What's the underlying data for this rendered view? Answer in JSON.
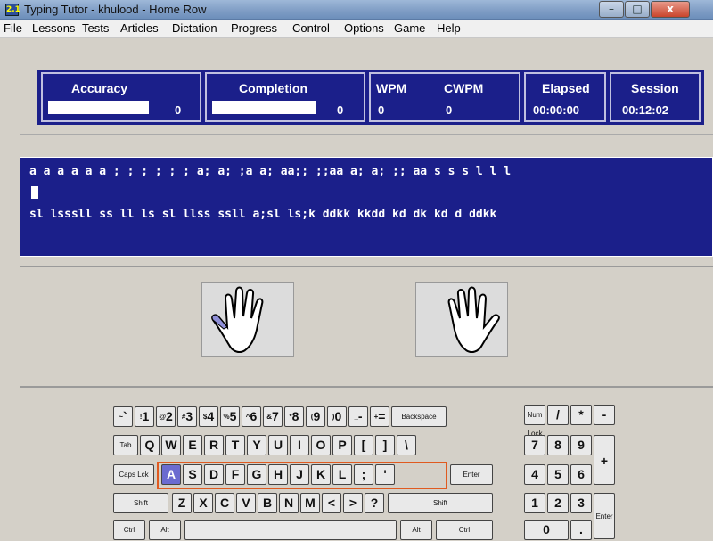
{
  "window": {
    "title": "Typing Tutor - khulood - Home Row",
    "icon_text": "2.1",
    "controls": {
      "minimize": "–",
      "maximize": "□",
      "close": "x"
    }
  },
  "menu": [
    "File",
    "Lessons",
    "Tests",
    "Articles",
    "Dictation",
    "Progress",
    "Control",
    "Options",
    "Game",
    "Help"
  ],
  "stats": {
    "accuracy": {
      "label": "Accuracy",
      "value": "0"
    },
    "completion": {
      "label": "Completion",
      "value": "0"
    },
    "wpm": {
      "label": "WPM",
      "value": "0"
    },
    "cwpm": {
      "label": "CWPM",
      "value": "0"
    },
    "elapsed": {
      "label": "Elapsed",
      "value": "00:00:00"
    },
    "session": {
      "label": "Session",
      "value": "00:12:02"
    }
  },
  "typing": {
    "line1": "a a a a a a ; ; ; ; ; ; a; a; ;a a; aa;; ;;aa a; a; ;; aa s s s l l l",
    "line2": "sl lsssll ss ll ls sl llss ssll a;sl ls;k ddkk kkdd kd dk kd d ddkk"
  },
  "keyboard": {
    "row1": [
      {
        "k": "`",
        "s": "~"
      },
      {
        "k": "1",
        "s": "!"
      },
      {
        "k": "2",
        "s": "@"
      },
      {
        "k": "3",
        "s": "#"
      },
      {
        "k": "4",
        "s": "$"
      },
      {
        "k": "5",
        "s": "%"
      },
      {
        "k": "6",
        "s": "^"
      },
      {
        "k": "7",
        "s": "&"
      },
      {
        "k": "8",
        "s": "*"
      },
      {
        "k": "9",
        "s": "("
      },
      {
        "k": "0",
        "s": ")"
      },
      {
        "k": "-",
        "s": "_"
      },
      {
        "k": "=",
        "s": "+"
      },
      {
        "k": "Backspace",
        "s": ""
      }
    ],
    "row2": [
      "Tab",
      "Q",
      "W",
      "E",
      "R",
      "T",
      "Y",
      "U",
      "I",
      "O",
      "P",
      "[",
      "]",
      "\\"
    ],
    "row3": [
      "Caps Lck",
      "A",
      "S",
      "D",
      "F",
      "G",
      "H",
      "J",
      "K",
      "L",
      ";",
      "'",
      "Enter"
    ],
    "row4": [
      "Shift",
      "Z",
      "X",
      "C",
      "V",
      "B",
      "N",
      "M",
      "<",
      ">",
      "?",
      "Shift"
    ],
    "row5": [
      "Ctrl",
      "Alt",
      "Alt",
      "Ctrl"
    ],
    "numpad": {
      "row1": [
        "Num Lock",
        "/",
        "*",
        "-"
      ],
      "row2": [
        "7",
        "8",
        "9",
        "+"
      ],
      "row3": [
        "4",
        "5",
        "6"
      ],
      "row4": [
        "1",
        "2",
        "3",
        "Enter"
      ],
      "row5": [
        "0",
        "."
      ]
    },
    "highlighted_key": "A"
  },
  "colors": {
    "panel_blue": "#1b1f8a",
    "highlight": "#6b6bd0",
    "home_row_outline": "#e05a20"
  }
}
